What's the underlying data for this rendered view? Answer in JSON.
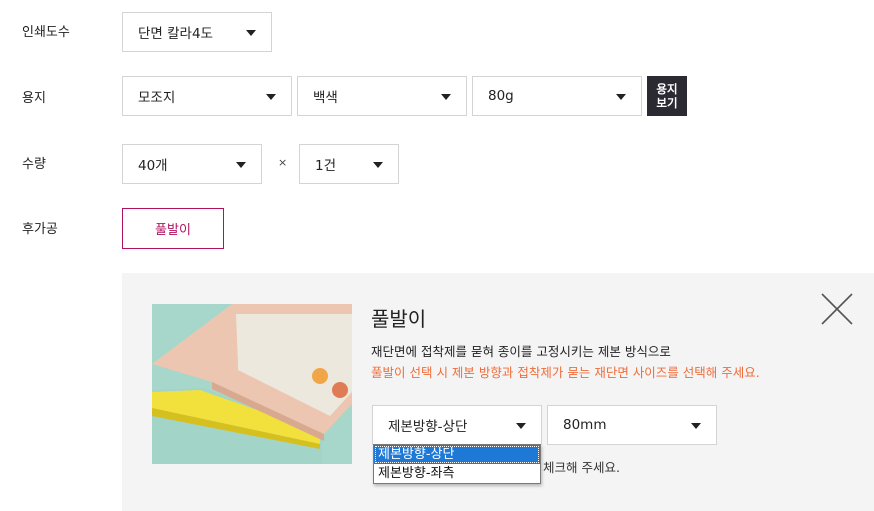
{
  "rows": {
    "print_color": {
      "label": "인쇄도수",
      "select": {
        "value": "단면 칼라4도"
      }
    },
    "paper": {
      "label": "용지",
      "type": {
        "value": "모조지"
      },
      "color": {
        "value": "백색"
      },
      "weight": {
        "value": "80g"
      },
      "view_button": {
        "line1": "용지",
        "line2": "보기"
      }
    },
    "quantity": {
      "label": "수량",
      "count": {
        "value": "40개"
      },
      "times": "×",
      "cases": {
        "value": "1건"
      }
    },
    "post_processing": {
      "label": "후가공",
      "option_button": "풀발이"
    }
  },
  "panel": {
    "title": "풀발이",
    "description": "재단면에 접착제를 묻혀 종이를 고정시키는 제본 방식으로",
    "warning": "풀발이 선택 시 제본 방향과 접착제가 묻는 재단면 사이즈를 선택해 주세요.",
    "direction_select": {
      "value": "제본방향-상단"
    },
    "size_select": {
      "value": "80mm"
    },
    "direction_options": [
      "제본방향-상단",
      "제본방향-좌측"
    ],
    "note": "체크해 주세요."
  },
  "colors": {
    "accent": "#b0125f",
    "warning": "#f06d3a",
    "button_dark": "#2b2a33",
    "panel_bg": "#f4f4f4"
  }
}
